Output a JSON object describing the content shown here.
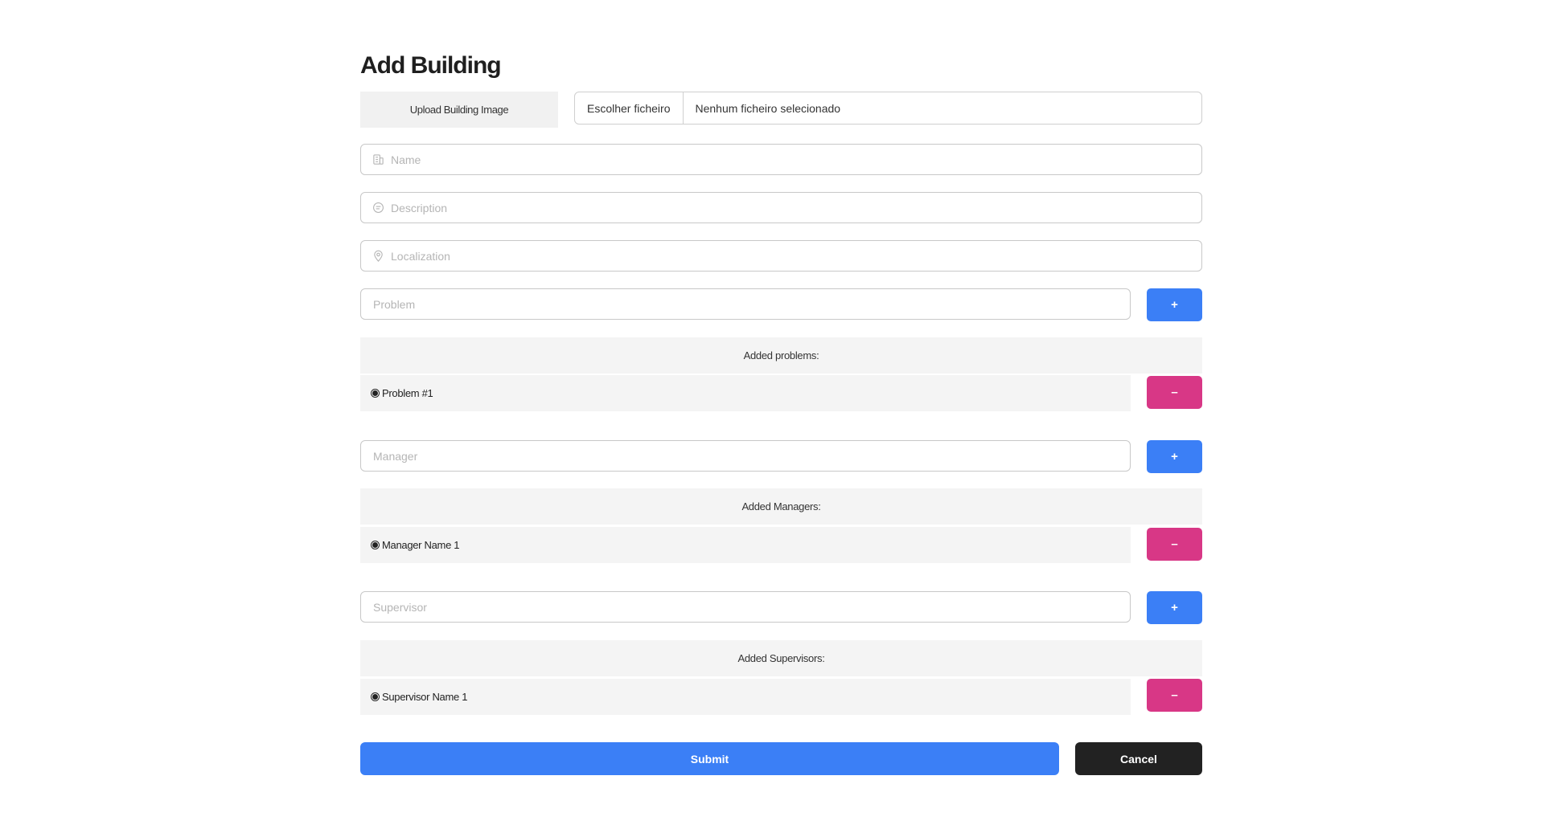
{
  "page": {
    "title": "Add Building"
  },
  "upload": {
    "label": "Upload Building Image",
    "button_label": "Escolher ficheiro",
    "status": "Nenhum ficheiro selecionado"
  },
  "fields": {
    "name": {
      "placeholder": "Name",
      "icon": "building-icon"
    },
    "description": {
      "placeholder": "Description",
      "icon": "message-icon"
    },
    "localization": {
      "placeholder": "Localization",
      "icon": "map-pin-icon"
    }
  },
  "problems": {
    "placeholder": "Problem",
    "add_label": "+",
    "header": "Added problems:",
    "items": [
      {
        "label": "Problem #1",
        "remove_label": "–"
      }
    ]
  },
  "managers": {
    "placeholder": "Manager",
    "add_label": "+",
    "header": "Added Managers:",
    "items": [
      {
        "label": "Manager Name 1",
        "remove_label": "–"
      }
    ]
  },
  "supervisors": {
    "placeholder": "Supervisor",
    "add_label": "+",
    "header": "Added Supervisors:",
    "items": [
      {
        "label": "Supervisor Name 1",
        "remove_label": "–"
      }
    ]
  },
  "actions": {
    "submit_label": "Submit",
    "cancel_label": "Cancel"
  },
  "colors": {
    "primary": "#3b7ff6",
    "danger": "#d83786",
    "dark": "#222222",
    "panel": "#f4f4f4"
  }
}
